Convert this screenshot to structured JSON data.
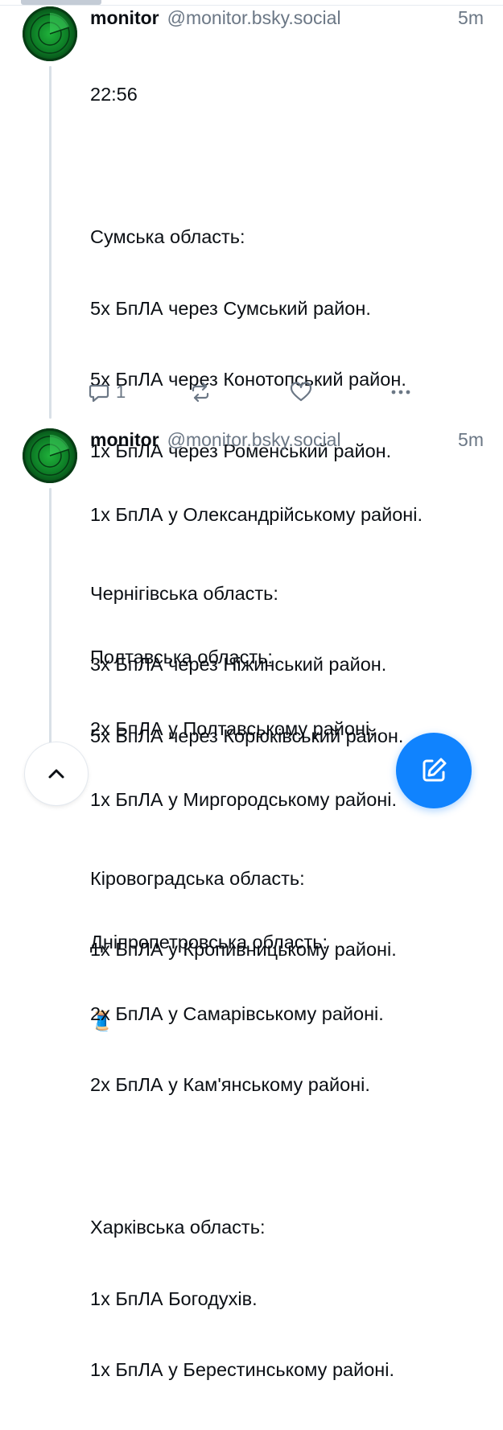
{
  "posts": [
    {
      "author": {
        "name": "monitor",
        "handle": "@monitor.bsky.social"
      },
      "time": "5m",
      "lines": [
        "22:56",
        "",
        "Сумська область:",
        "5х БпЛА через Сумський район.",
        "5х БпЛА через Конотопський район.",
        "1х БпЛА через Роменський район.",
        "",
        "Чернігівська область:",
        "3х БпЛА через Ніжинський район.",
        "5х БпЛА через Корюківський район.",
        "",
        "Кіровоградська область:",
        "1х БпЛА у Кропивницькому районі.",
        "🧵"
      ],
      "actions": {
        "reply_count": "1",
        "reply_icon": "reply-icon",
        "repost_icon": "repost-icon",
        "like_icon": "heart-icon",
        "more_icon": "more-icon"
      }
    },
    {
      "author": {
        "name": "monitor",
        "handle": "@monitor.bsky.social"
      },
      "time": "5m",
      "lines": [
        "1х БпЛА у Олександрійському районі.",
        "",
        "Полтавська область:",
        "2х БпЛА у Полтавському районі.",
        "1х БпЛА у Миргородському районі.",
        "",
        "Дніпропетровська область:",
        "2х БпЛА у Самарівському районі.",
        "2х БпЛА у Кам'янському районі.",
        "",
        "Харківська область:",
        "1х БпЛА Богодухів.",
        "1х БпЛА у Берестинському районі."
      ]
    }
  ],
  "buttons": {
    "scroll_top_icon": "chevron-up-icon",
    "compose_icon": "compose-icon"
  },
  "colors": {
    "accent": "#1083fe",
    "muted": "#6b7785",
    "text": "#0b0f14",
    "avatar_green": "#0d7d26"
  }
}
